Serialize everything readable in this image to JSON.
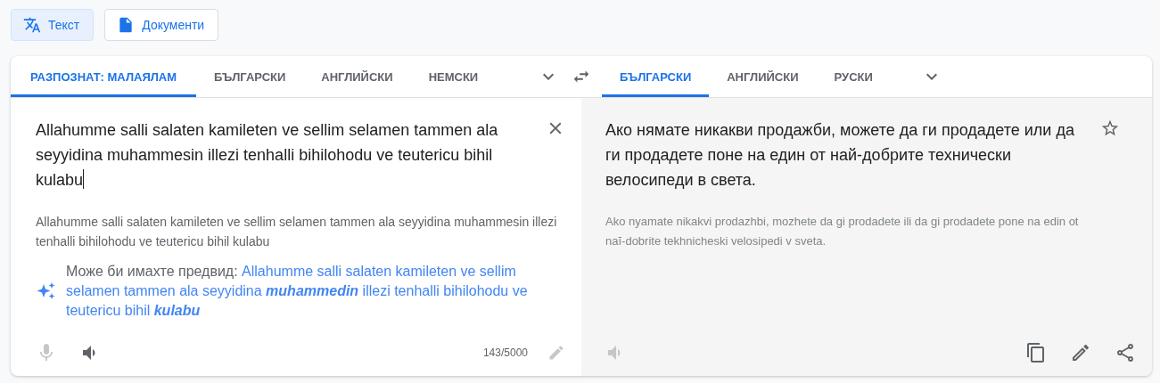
{
  "modes": [
    {
      "label": "Текст",
      "kind": "translate",
      "selected": true
    },
    {
      "label": "Документи",
      "kind": "document",
      "selected": false
    }
  ],
  "source_languages": [
    {
      "label": "РАЗПОЗНАТ: МАЛАЯЛАМ",
      "selected": true
    },
    {
      "label": "БЪЛГАРСКИ",
      "selected": false
    },
    {
      "label": "АНГЛИЙСКИ",
      "selected": false
    },
    {
      "label": "НЕМСКИ",
      "selected": false
    }
  ],
  "target_languages": [
    {
      "label": "БЪЛГАРСКИ",
      "selected": true
    },
    {
      "label": "АНГЛИЙСКИ",
      "selected": false
    },
    {
      "label": "РУСКИ",
      "selected": false
    }
  ],
  "source": {
    "value": "Allahumme salli salaten kamileten ve sellim selamen tammen ala seyyidina muhammesin illezi tenhalli bihilohodu ve teutericu bihil kulabu",
    "transliteration": "Allahumme salli salaten kamileten ve sellim selamen tammen ala seyyidina muhammesin illezi tenhalli bihilohodu ve teutericu bihil kulabu",
    "suggestion_prefix": "Може би имахте предвид:",
    "suggestion": "Allahumme salli salaten kamileten ve sellim selamen tammen ala seyyidina **muhammedin** illezi tenhalli bihilohodu ve teutericu bihil **kulabu**",
    "mic_disabled": true,
    "listen_disabled": false,
    "char_count": "143/5000"
  },
  "target": {
    "value": "Ако нямате никакви продажби, можете да ги продадете или да ги продадете поне на един от най-добрите технически велосипеди в света.",
    "transliteration": "Ako nyamate nikakvi prodazhbi, mozhete da gi prodadete ili da gi prodadete pone na edin ot naĭ-dobrite tekhnicheski velosipedi v sveta.",
    "listen_disabled": true
  }
}
